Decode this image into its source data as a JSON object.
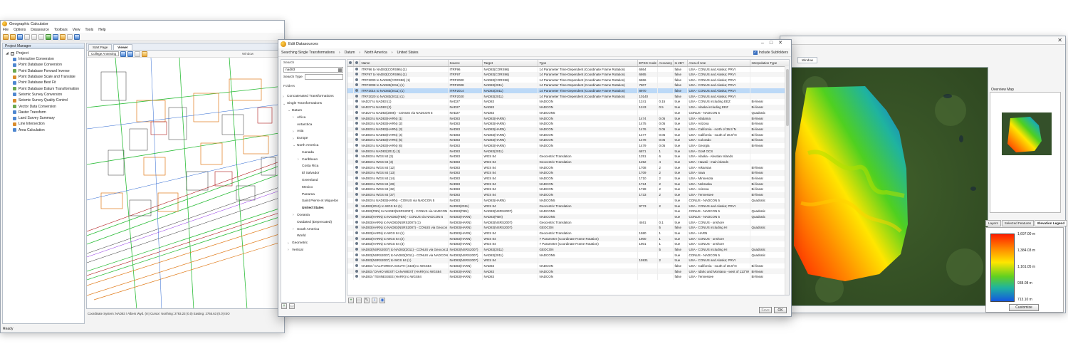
{
  "left_window": {
    "title": "Geographic Calculator",
    "menu": [
      "File",
      "Options",
      "Datasource",
      "Toolbars",
      "View",
      "Tools",
      "Help"
    ],
    "project_manager_title": "Project Manager",
    "project_root": "Project",
    "project_items": [
      "Interactive Conversion",
      "Point Database Conversion",
      "Point Database Forward Inverse",
      "Point Database Scale and Translate",
      "Point Database Best Fit",
      "Point Database Datum Transformation",
      "Seismic Survey Conversion",
      "Seismic Survey Quality Control",
      "Vector Data Conversion",
      "Raster Transform",
      "Land Survey Summary",
      "Line Intersection",
      "Area Calculation"
    ],
    "map_tabs": [
      "Start Page",
      "Viewer"
    ],
    "map_layer_label": "College Annexing",
    "window_tab": "Window",
    "status": "Coordinate System:   NAD83 / Albers Wyd. (m)   Cursor:   Northing:   2793.23 (0.0)   Easting:   2765.63 (0.0)   ISO",
    "ready": "Ready"
  },
  "right_window": {
    "tab": "Window",
    "overview_title": "Overview Map",
    "legend_tabs": [
      "Layers",
      "Selected Features",
      "Elevation Legend"
    ],
    "legend_labels": [
      "1,697.00 m",
      "1,384.03 m",
      "1,161.05 m",
      "938.08 m",
      "713.10 m"
    ],
    "customize": "Customize",
    "coord": "Co"
  },
  "dialog": {
    "title": "Edit Datasources",
    "breadcrumb": [
      "Searching Single Transformations",
      "Datum",
      "North America",
      "United States"
    ],
    "include_subfolders": "Include Subfolders",
    "search_label": "Search",
    "search_value": "nad83",
    "search_type_label": "Search Type",
    "folders_label": "Folders",
    "tree": [
      {
        "label": "Concatenated Transformations",
        "indent": 1,
        "arrow": "›",
        "bold": false
      },
      {
        "label": "Single Transformations",
        "indent": 1,
        "arrow": "⌄",
        "bold": false
      },
      {
        "label": "Datum",
        "indent": 2,
        "arrow": "⌄",
        "bold": false
      },
      {
        "label": "Africa",
        "indent": 3,
        "arrow": "›",
        "bold": false
      },
      {
        "label": "Antarctica",
        "indent": 3,
        "arrow": "",
        "bold": false
      },
      {
        "label": "Asia",
        "indent": 3,
        "arrow": "›",
        "bold": false
      },
      {
        "label": "Europe",
        "indent": 3,
        "arrow": "›",
        "bold": false
      },
      {
        "label": "North America",
        "indent": 3,
        "arrow": "⌄",
        "bold": false
      },
      {
        "label": "Canada",
        "indent": 4,
        "arrow": "",
        "bold": false
      },
      {
        "label": "Caribbean",
        "indent": 4,
        "arrow": "›",
        "bold": false
      },
      {
        "label": "Costa Rica",
        "indent": 4,
        "arrow": "",
        "bold": false
      },
      {
        "label": "El Salvador",
        "indent": 4,
        "arrow": "",
        "bold": false
      },
      {
        "label": "Greenland",
        "indent": 4,
        "arrow": "",
        "bold": false
      },
      {
        "label": "Mexico",
        "indent": 4,
        "arrow": "",
        "bold": false
      },
      {
        "label": "Panama",
        "indent": 4,
        "arrow": "",
        "bold": false
      },
      {
        "label": "Saint Pierre et Miquelon",
        "indent": 4,
        "arrow": "",
        "bold": false
      },
      {
        "label": "United States",
        "indent": 4,
        "arrow": "",
        "bold": true
      },
      {
        "label": "Oceania",
        "indent": 3,
        "arrow": "›",
        "bold": false
      },
      {
        "label": "Outdated (Deprecated)",
        "indent": 3,
        "arrow": "",
        "bold": false
      },
      {
        "label": "South America",
        "indent": 3,
        "arrow": "›",
        "bold": false
      },
      {
        "label": "World",
        "indent": 3,
        "arrow": "",
        "bold": false
      },
      {
        "label": "Geometric",
        "indent": 2,
        "arrow": "›",
        "bold": false
      },
      {
        "label": "Vertical",
        "indent": 2,
        "arrow": "›",
        "bold": false
      }
    ],
    "columns": [
      "Name",
      "Source",
      "Target",
      "Type",
      "EPSG Code",
      "Accuracy",
      "Is 2D?",
      "Area of Use",
      "Interpolation Type"
    ],
    "rows": [
      [
        "ITRF96 to NAD83(CORS96) (1)",
        "ITRF96",
        "NAD83(CORS96)",
        "14 Parameter Time-Dependent (Coordinate Frame Rotation)",
        "6864",
        "",
        "false",
        "USA - CONUS and Alaska; PRVI",
        ""
      ],
      [
        "ITRF97 to NAD83(CORS96) (1)",
        "ITRF97",
        "NAD83(CORS96)",
        "14 Parameter Time-Dependent (Coordinate Frame Rotation)",
        "6865",
        "",
        "false",
        "USA - CONUS and Alaska; PRVI",
        ""
      ],
      [
        "ITRF2000 to NAD83(CORS96) (1)",
        "ITRF2000",
        "NAD83(CORS96)",
        "14 Parameter Time-Dependent (Coordinate Frame Rotation)",
        "6866",
        "",
        "false",
        "USA - CONUS and Alaska; PRVI",
        ""
      ],
      [
        "ITRF2008 to NAD83(2011) (1)",
        "ITRF2008",
        "NAD83(2011)",
        "14 Parameter Time-Dependent (Coordinate Frame Rotation)",
        "7807",
        "",
        "false",
        "USA - CONUS and Alaska; PRVI",
        ""
      ],
      [
        "ITRF2014 to NAD83(2011) (1)",
        "ITRF2014",
        "NAD83(2011)",
        "14 Parameter Time-Dependent (Coordinate Frame Rotation)",
        "8970",
        "",
        "false",
        "USA - CONUS and Alaska; PRVI",
        ""
      ],
      [
        "ITRF2020 to NAD83(2011) (1)",
        "ITRF2020",
        "NAD83(2011)",
        "14 Parameter Time-Dependent (Coordinate Frame Rotation)",
        "10140",
        "",
        "false",
        "USA - CONUS and Alaska; PRVI",
        ""
      ],
      [
        "NAD27 to NAD83 (1)",
        "NAD27",
        "NAD83",
        "NADCON",
        "1241",
        "0.15",
        "true",
        "USA - CONUS including EEZ",
        "Bi-linear"
      ],
      [
        "NAD27 to NAD83 (2)",
        "NAD27",
        "NAD83",
        "NADCON",
        "1243",
        "0.5",
        "true",
        "USA - Alaska including EEZ",
        "Bi-linear"
      ],
      [
        "NAD27 to NAD83(2086) - CONUS via NADCON 5",
        "NAD27",
        "NAD83",
        "NADCON5",
        "",
        "",
        "true",
        "CONUS - NADCON 5",
        "Quadratic"
      ],
      [
        "NAD83 to NAD83(HARN) (1)",
        "NAD83",
        "NAD83(HARN)",
        "NADCON",
        "1474",
        "0.05",
        "true",
        "USA - Alabama",
        "Bi-linear"
      ],
      [
        "NAD83 to NAD83(HARN) (2)",
        "NAD83",
        "NAD83(HARN)",
        "NADCON",
        "1475",
        "0.05",
        "true",
        "USA - Arizona",
        "Bi-linear"
      ],
      [
        "NAD83 to NAD83(HARN) (3)",
        "NAD83",
        "NAD83(HARN)",
        "NADCON",
        "1476",
        "0.05",
        "true",
        "USA - California - north of 36.5°N",
        "Bi-linear"
      ],
      [
        "NAD83 to NAD83(HARN) (4)",
        "NAD83",
        "NAD83(HARN)",
        "NADCON",
        "1477",
        "0.05",
        "true",
        "USA - California - south of 36.5°N",
        "Bi-linear"
      ],
      [
        "NAD83 to NAD83(HARN) (5)",
        "NAD83",
        "NAD83(HARN)",
        "NADCON",
        "1478",
        "0.05",
        "true",
        "USA - Colorado",
        "Bi-linear"
      ],
      [
        "NAD83 to NAD83(HARN) (6)",
        "NAD83",
        "NAD83(HARN)",
        "NADCON",
        "1479",
        "0.05",
        "true",
        "USA - Georgia",
        "Bi-linear"
      ],
      [
        "NAD83 to NAD83(2011) (1)",
        "NAD83",
        "NAD83(2011)",
        "",
        "6871",
        "1",
        "true",
        "USA - GoM OCS",
        ""
      ],
      [
        "NAD83 to WGS 84 (2)",
        "NAD83",
        "WGS 84",
        "Geocentric Translation",
        "1251",
        "6",
        "true",
        "USA - Alaska - Aleutian Islands",
        ""
      ],
      [
        "NAD83 to WGS 84 (3)",
        "NAD83",
        "WGS 84",
        "Geocentric Translation",
        "1252",
        "4",
        "true",
        "USA - Hawaii - main islands",
        ""
      ],
      [
        "NAD83 to WGS 84 (12)",
        "NAD83",
        "WGS 84",
        "NADCON",
        "1708",
        "2",
        "true",
        "USA - Arkansas",
        "Bi-linear"
      ],
      [
        "NAD83 to WGS 84 (13)",
        "NAD83",
        "WGS 84",
        "NADCON",
        "1709",
        "2",
        "true",
        "USA - Iowa",
        "Bi-linear"
      ],
      [
        "NAD83 to WGS 84 (14)",
        "NAD83",
        "WGS 84",
        "NADCON",
        "1710",
        "2",
        "true",
        "USA - Minnesota",
        "Bi-linear"
      ],
      [
        "NAD83 to WGS 84 (28)",
        "NAD83",
        "WGS 84",
        "NADCON",
        "1724",
        "2",
        "true",
        "USA - Nebraska",
        "Bi-linear"
      ],
      [
        "NAD83 to WGS 84 (32)",
        "NAD83",
        "WGS 84",
        "NADCON",
        "1728",
        "2",
        "true",
        "USA - Arizona",
        "Bi-linear"
      ],
      [
        "NAD83 to WGS 84 (37)",
        "NAD83",
        "WGS 84",
        "NADCON",
        "1733",
        "2",
        "true",
        "USA - Tennessee",
        "Bi-linear"
      ],
      [
        "NAD83 to NAD83(HARN) - CONUS via NADCON 5",
        "NAD83",
        "NAD83(HARN)",
        "NADCON5",
        "",
        "",
        "true",
        "CONUS - NADCON 5",
        "Quadratic"
      ],
      [
        "NAD83(2011) to WGS 84 (1)",
        "NAD83(2011)",
        "WGS 84",
        "Geocentric Translation",
        "9773",
        "2",
        "true",
        "USA - CONUS and Alaska; PRVI",
        ""
      ],
      [
        "NAD83(FBN) to NAD83(NSRS2007) - CONUS via NADCON 5",
        "NAD83(FBN)",
        "NAD83(NSRS2007)",
        "NADCON5",
        "",
        "",
        "true",
        "CONUS - NADCON 5",
        "Quadratic"
      ],
      [
        "NAD83(HARN) to NAD83(FBN) - CONUS via NADCON 5",
        "NAD83(HARN)",
        "NAD83(FBN)",
        "NADCON5",
        "",
        "",
        "true",
        "CONUS - NADCON 5",
        "Quadratic"
      ],
      [
        "NAD83(HARN) to NAD83(NSRS2007) (1)",
        "NAD83(HARN)",
        "NAD83(NSRS2007)",
        "Geocentric Translation",
        "4461",
        "0.1",
        "true",
        "USA - CONUS - onshore",
        ""
      ],
      [
        "NAD83(HARN) to NAD83(NSRS2007) - CONUS via Geocon",
        "NAD83(HARN)",
        "NAD83(NSRS2007)",
        "GEOCON",
        "",
        "5",
        "false",
        "USA - CONUS including HI",
        "Quadratic"
      ],
      [
        "NAD83(HARN) to WGS 84 (1)",
        "NAD83(HARN)",
        "WGS 84",
        "Geocentric Translation",
        "1580",
        "1",
        "true",
        "USA - HARN",
        ""
      ],
      [
        "NAD83(HARN) to WGS 84 (2)",
        "NAD83(HARN)",
        "WGS 84",
        "7 Parameter (Coordinate Frame Rotation)",
        "1900",
        "1",
        "true",
        "USA - CONUS - onshore",
        ""
      ],
      [
        "NAD83(HARN) to WGS 84 (3)",
        "NAD83(HARN)",
        "WGS 84",
        "7 Parameter (Coordinate Frame Rotation)",
        "1901",
        "1",
        "true",
        "USA - CONUS - onshore",
        ""
      ],
      [
        "NAD83(NSRS2007) to NAD83(2011) - CONUS via Geocon11",
        "NAD83(NSRS2007)",
        "NAD83(2011)",
        "GEOCON",
        "",
        "5",
        "false",
        "USA - CONUS including HI",
        "Quadratic"
      ],
      [
        "NAD83(NSRS2007) to NAD83(2011) - CONUS via NADCON 5",
        "NAD83(NSRS2007)",
        "NAD83(2011)",
        "NADCON5",
        "",
        "",
        "true",
        "CONUS - NADCON 5",
        "Quadratic"
      ],
      [
        "NAD83(NSRS2007) to WGS 84 (1)",
        "NAD83(NSRS2007)",
        "WGS 84",
        "",
        "15931",
        "2",
        "true",
        "USA - CONUS and Alaska; PRVI",
        ""
      ],
      [
        "NAD83 / CALIFORNIA SOUTH (4436) to WGS84",
        "NAD83(HARN)",
        "NAD83",
        "NADCON",
        "",
        "",
        "false",
        "USA - California - south of 36.5°N",
        "Bi-linear"
      ],
      [
        "NAD83 / DAHO WEST/ CANAWEST (HARN) to WGS84",
        "NAD83(HARN)",
        "NAD83",
        "NADCON",
        "",
        "",
        "false",
        "USA - Idaho and Montana - west of 113°W",
        "Bi-linear"
      ],
      [
        "NAD83 / TENNESSEE (HARN) to WGS84",
        "NAD83(HARN)",
        "NAD83",
        "NADCON",
        "",
        "",
        "false",
        "USA - Tennessee",
        "Bi-linear"
      ]
    ],
    "selected_row": 4,
    "buttons": {
      "save": "Save",
      "ok": "OK"
    }
  },
  "colors": {
    "selection": "#bcd9f7",
    "elevation_high": "#ff1d00",
    "elevation_low": "#1457e0"
  }
}
